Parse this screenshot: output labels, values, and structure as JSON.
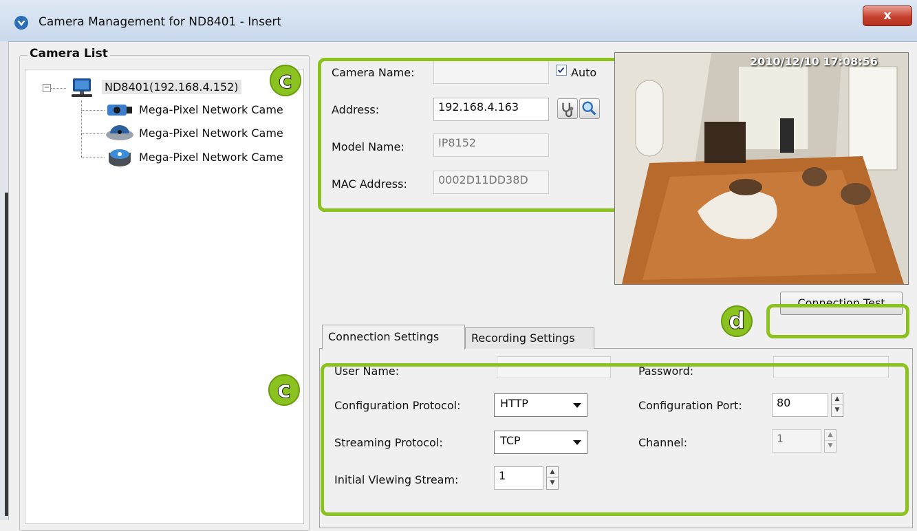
{
  "window": {
    "title": "Camera Management for ND8401 - Insert",
    "close_label": "x"
  },
  "camera_list": {
    "legend": "Camera List",
    "root": {
      "label": "ND8401(192.168.4.152)",
      "expander": "−"
    },
    "cameras": [
      {
        "label": "Mega-Pixel Network Came",
        "icon": "box-camera-icon"
      },
      {
        "label": "Mega-Pixel Network Came",
        "icon": "dome-camera-icon"
      },
      {
        "label": "Mega-Pixel Network Came",
        "icon": "fisheye-camera-icon"
      }
    ]
  },
  "camera_info": {
    "camera_name_label": "Camera Name:",
    "camera_name_value": "",
    "auto_label": "Auto",
    "auto_checked": true,
    "address_label": "Address:",
    "address_value": "192.168.4.163",
    "model_name_label": "Model Name:",
    "model_name_value": "IP8152",
    "mac_address_label": "MAC Address:",
    "mac_address_value": "0002D11DD38D"
  },
  "preview": {
    "timestamp": "2010/12/10  17:08:56"
  },
  "connection_test_label": "Connection Test",
  "tabs": [
    {
      "label": "Connection Settings",
      "active": true
    },
    {
      "label": "Recording Settings",
      "active": false
    }
  ],
  "connection_settings": {
    "user_name_label": "User Name:",
    "user_name_value": "",
    "password_label": "Password:",
    "password_value": "",
    "config_protocol_label": "Configuration Protocol:",
    "config_protocol_value": "HTTP",
    "config_port_label": "Configuration Port:",
    "config_port_value": "80",
    "streaming_protocol_label": "Streaming Protocol:",
    "streaming_protocol_value": "TCP",
    "channel_label": "Channel:",
    "channel_value": "1",
    "initial_stream_label": "Initial Viewing Stream:",
    "initial_stream_value": "1"
  },
  "callouts": {
    "c1": "c",
    "c2": "c",
    "d": "d"
  },
  "colors": {
    "highlight": "#8cc21f",
    "close": "#c7402f"
  }
}
